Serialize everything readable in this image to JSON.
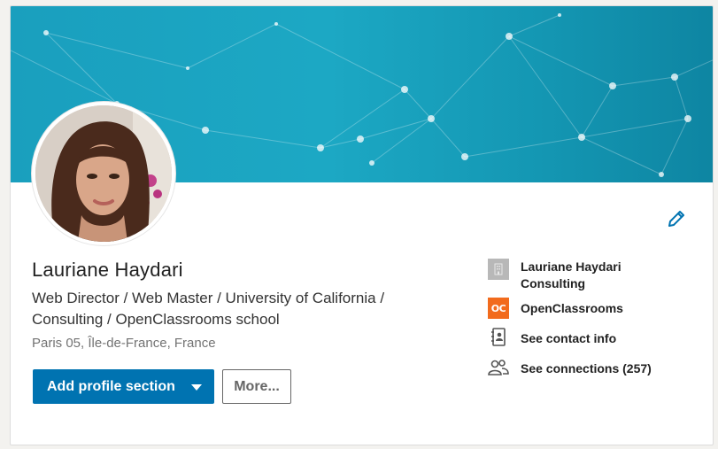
{
  "profile": {
    "name": "Lauriane Haydari",
    "headline": "Web Director / Web Master / University of California / Consulting / OpenClassrooms school",
    "location": "Paris 05, Île-de-France, France"
  },
  "actions": {
    "add_section_label": "Add profile section",
    "more_label": "More..."
  },
  "sidebar": {
    "company": "Lauriane Haydari Consulting",
    "school": "OpenClassrooms",
    "school_logo_text": "OC",
    "contact_info": "See contact info",
    "connections": "See connections (257)"
  },
  "colors": {
    "primary": "#0073b1",
    "banner": "#1ca8c4",
    "school_logo": "#f26b1d"
  },
  "icons": [
    "pencil-icon",
    "building-icon",
    "contact-book-icon",
    "people-icon",
    "caret-down-icon"
  ]
}
